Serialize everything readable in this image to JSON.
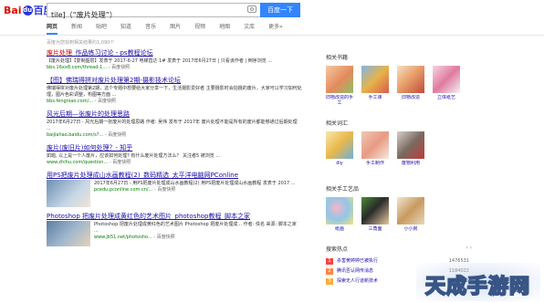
{
  "logo": {
    "du": "Bai",
    "paw": "du",
    "bai": "百度"
  },
  "search": {
    "value": "tile]（“废片处理”）",
    "button": "百度一下"
  },
  "tabs": [
    "网页",
    "新闻",
    "贴吧",
    "知道",
    "音乐",
    "图片",
    "视频",
    "地图",
    "文库",
    "更多»"
  ],
  "result_count": "百度为您找到相关结果约1,090个",
  "results": [
    {
      "title_hl": "废片处理",
      "title_rest": "_作品练习讨论 - ps教程论坛",
      "abstract": "【废片处理】【复制图层】发表于 2017-6-27  电梯直达 1# 发表于 2017年6月27日 | 只看该作者 | 倒序浏览 ...",
      "url": "bbs.16xx8.com/thread-1...",
      "snap": "- 百度快照"
    },
    {
      "title_hl": "【图】佛瑞得拼对废片处理第2期-摄影技术论坛",
      "title_rest": "",
      "abstract": "佛瑞得拼对废片处理第2期，这个专题中想要给大家分享一下，生活摄影爱好者 主要摄影时会拍摄的废片，大家可以学习如何处理，图片色彩调整，构图等方面 ...",
      "url": "bbs.fengniao.com/...",
      "snap": "- 百度快照"
    },
    {
      "title_hl": "风光后期—张废片的处理思路",
      "title_rest": "",
      "abstract": "2017年6月27日 - 风光后期一张废片的处理思路 作者: 吴伟 发布于 2017年 废片处理不能是所有的废片都能够通过后期处理 ...",
      "url": "baijiahao.baidu.com/s?...",
      "snap": "- 百度快照"
    },
    {
      "title_hl": "废片(废旧片)如何处理？- 知乎",
      "title_rest": "",
      "abstract": "如题, 以上是一个人废片，应该如何处理? 有什么废片处理方法么？ 关注者5 被浏览 ...",
      "url": "www.zhihu.com/question...",
      "snap": "- 百度快照"
    },
    {
      "title_hl": "用PS把废片处理成山水画教程(2)_数码精选_太平洋电脑网PConline",
      "title_rest": "",
      "abstract": "2017年6月27日 - 用PS把废片处理成山水画教程(2) 用PS把废片处理成山水画教程 发表于 2017 ...",
      "url": "pcedu.pconline.com.cn/...",
      "snap": "- 百度快照"
    },
    {
      "title_hl": "Photoshop 把废片处理成黄红色的艺术图片_photoshop教程_脚本之家",
      "title_rest": "",
      "abstract": "Photoshop 把废片处理成黄红色的艺术图片 Photoshop 把废片处理成... 作者: 佚名 来源: 脚本之家 ...",
      "url": "www.jb51.net/photosho...",
      "snap": "- 百度快照"
    }
  ],
  "side": {
    "sections": [
      {
        "title": "相关书籍",
        "items": [
          {
            "caption": "旧物改造的手工"
          },
          {
            "caption": "手工课"
          },
          {
            "caption": "旧物改造"
          },
          {
            "caption": "立体纸艺"
          }
        ]
      },
      {
        "title": "相关词汇",
        "items": [
          {
            "caption": "diy"
          },
          {
            "caption": "手工制作"
          },
          {
            "caption": "废物利用"
          }
        ]
      },
      {
        "title": "相关手工艺品",
        "items": [
          {
            "caption": "纸画"
          },
          {
            "caption": "三角面"
          },
          {
            "caption": "小小房"
          }
        ]
      }
    ],
    "hot_title": "搜索热点",
    "hot_nav": "‹ ›",
    "hot": [
      {
        "num": "1",
        "text": "杀害黄婷婷已被执行",
        "val": "1476531"
      },
      {
        "num": "2",
        "text": "腾讯否认网传消息",
        "val": "1184022"
      },
      {
        "num": "3",
        "text": "探索无人行道新技术",
        "val": "1055201"
      }
    ]
  },
  "watermark": {
    "text": "天成手游网"
  },
  "colors": {
    "accent": "#3385ff",
    "link": "#1a0dab",
    "url": "#008000",
    "highlight": "#c00000"
  }
}
